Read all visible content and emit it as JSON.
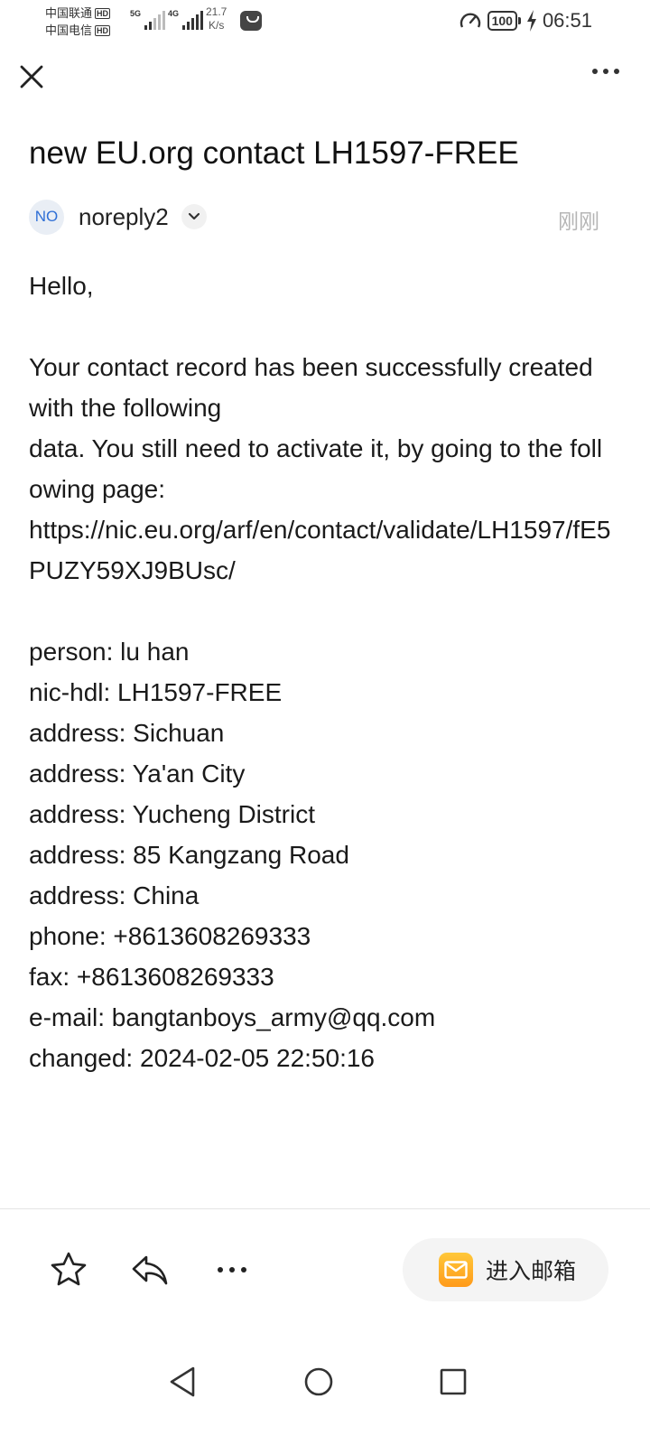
{
  "status_bar": {
    "carrier1": "中国联通",
    "carrier2": "中国电信",
    "hd_badge": "HD",
    "net1": "5G",
    "net2": "4G",
    "speed_value": "21.7",
    "speed_unit": "K/s",
    "battery": "100",
    "time": "06:51"
  },
  "toolbar_top": {
    "close_icon": "close-icon",
    "more_icon": "more-horizontal-icon"
  },
  "email": {
    "subject": "new EU.org contact LH1597-FREE",
    "sender_avatar": "NO",
    "sender_name": "noreply2",
    "time": "刚刚",
    "greeting": "Hello,",
    "intro_line1": "Your contact record has been successfully created with the following",
    "intro_line2": "data. You still need to activate it, by going to the following page:",
    "link": "https://nic.eu.org/arf/en/contact/validate/LH1597/fE5PUZY59XJ9BUsc/",
    "fields": [
      "person: lu han",
      "nic-hdl: LH1597-FREE",
      "address: Sichuan",
      "address: Ya'an City",
      "address: Yucheng District",
      "address: 85 Kangzang Road",
      "address: China",
      "phone: +8613608269333",
      "fax: +8613608269333",
      "e-mail: bangtanboys_army@qq.com",
      "changed: 2024-02-05 22:50:16"
    ]
  },
  "bottom_bar": {
    "star_icon": "star-icon",
    "reply_icon": "reply-icon",
    "more_icon": "more-horizontal-icon",
    "enter_mailbox_label": "进入邮箱"
  },
  "nav_bar": {
    "back_icon": "back-triangle-icon",
    "home_icon": "home-circle-icon",
    "recents_icon": "recents-square-icon"
  },
  "colors": {
    "avatar_bg": "#e9eef5",
    "avatar_text": "#2f6fd6",
    "mail_icon": "#ffb22a",
    "time_gray": "#b5b5b5"
  }
}
